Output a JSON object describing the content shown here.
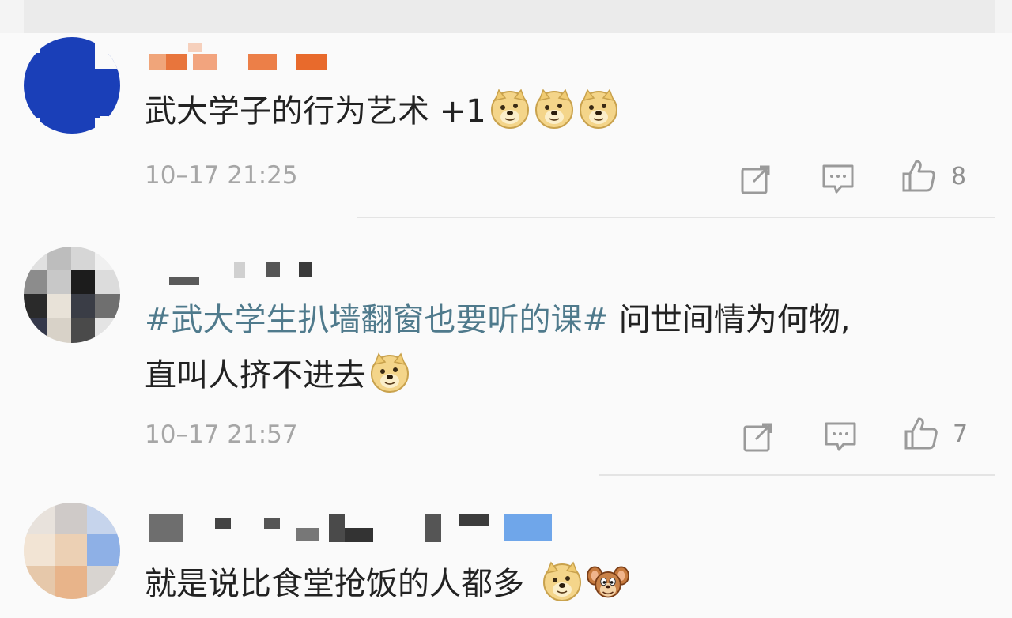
{
  "comments": [
    {
      "text": "武大学子的行为艺术 +1",
      "time": "10–17 21:25",
      "likes": "8",
      "emoji": [
        "doge",
        "doge",
        "doge"
      ]
    },
    {
      "hashtag": "#武大学生扒墙翻窗也要听的课#",
      "text_line1": " 问世间情为何物,",
      "text_line2": "直叫人挤不进去",
      "time": "10–17 21:57",
      "likes": "7",
      "emoji": [
        "doge"
      ]
    },
    {
      "text": "就是说比食堂抢饭的人都多",
      "emoji": [
        "doge",
        "jerry"
      ]
    }
  ],
  "icons": {
    "share": "share-icon",
    "reply": "comment-icon",
    "like": "thumbs-up-icon"
  },
  "colors": {
    "hashtag": "#4f7a8c",
    "avatar_blue": "#1a3fb8",
    "timestamp": "#a6a6a6"
  }
}
